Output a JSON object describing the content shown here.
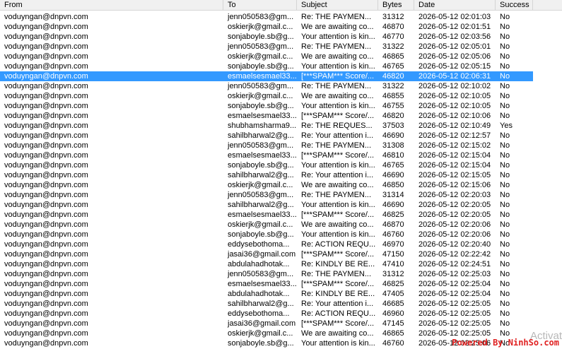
{
  "columns": [
    "From",
    "To",
    "Subject",
    "Bytes",
    "Date",
    "Success"
  ],
  "selected_index": 6,
  "rows": [
    [
      "voduyngan@dnpvn.com",
      "jenn050583@gm...",
      "Re: THE PAYMEN...",
      "31312",
      "2026-05-12 02:01:03",
      "No"
    ],
    [
      "voduyngan@dnpvn.com",
      "oskierjk@gmail.c...",
      "We are awaiting co...",
      "46870",
      "2026-05-12 02:01:51",
      "No"
    ],
    [
      "voduyngan@dnpvn.com",
      "sonjaboyle.sb@g...",
      "Your attention is kin...",
      "46770",
      "2026-05-12 02:03:56",
      "No"
    ],
    [
      "voduyngan@dnpvn.com",
      "jenn050583@gm...",
      "Re: THE PAYMEN...",
      "31322",
      "2026-05-12 02:05:01",
      "No"
    ],
    [
      "voduyngan@dnpvn.com",
      "oskierjk@gmail.c...",
      "We are awaiting co...",
      "46865",
      "2026-05-12 02:05:06",
      "No"
    ],
    [
      "voduyngan@dnpvn.com",
      "sonjaboyle.sb@g...",
      "Your attention is kin...",
      "46765",
      "2026-05-12 02:05:15",
      "No"
    ],
    [
      "voduyngan@dnpvn.com",
      "esmaelsesmael33...",
      "[***SPAM*** Score/...",
      "46820",
      "2026-05-12 02:06:31",
      "No"
    ],
    [
      "voduyngan@dnpvn.com",
      "jenn050583@gm...",
      "Re: THE PAYMEN...",
      "31322",
      "2026-05-12 02:10:02",
      "No"
    ],
    [
      "voduyngan@dnpvn.com",
      "oskierjk@gmail.c...",
      "We are awaiting co...",
      "46855",
      "2026-05-12 02:10:05",
      "No"
    ],
    [
      "voduyngan@dnpvn.com",
      "sonjaboyle.sb@g...",
      "Your attention is kin...",
      "46755",
      "2026-05-12 02:10:05",
      "No"
    ],
    [
      "voduyngan@dnpvn.com",
      "esmaelsesmael33...",
      "[***SPAM*** Score/...",
      "46820",
      "2026-05-12 02:10:06",
      "No"
    ],
    [
      "voduyngan@dnpvn.com",
      "shubhamsharma9...",
      "Re: THE REQUES...",
      "37503",
      "2026-05-12 02:10:49",
      "Yes"
    ],
    [
      "voduyngan@dnpvn.com",
      "sahilbharwal2@g...",
      "Re: Your attention i...",
      "46690",
      "2026-05-12 02:12:57",
      "No"
    ],
    [
      "voduyngan@dnpvn.com",
      "jenn050583@gm...",
      "Re: THE PAYMEN...",
      "31308",
      "2026-05-12 02:15:02",
      "No"
    ],
    [
      "voduyngan@dnpvn.com",
      "esmaelsesmael33...",
      "[***SPAM*** Score/...",
      "46810",
      "2026-05-12 02:15:04",
      "No"
    ],
    [
      "voduyngan@dnpvn.com",
      "sonjaboyle.sb@g...",
      "Your attention is kin...",
      "46765",
      "2026-05-12 02:15:04",
      "No"
    ],
    [
      "voduyngan@dnpvn.com",
      "sahilbharwal2@g...",
      "Re: Your attention i...",
      "46690",
      "2026-05-12 02:15:05",
      "No"
    ],
    [
      "voduyngan@dnpvn.com",
      "oskierjk@gmail.c...",
      "We are awaiting co...",
      "46850",
      "2026-05-12 02:15:06",
      "No"
    ],
    [
      "voduyngan@dnpvn.com",
      "jenn050583@gm...",
      "Re: THE PAYMEN...",
      "31314",
      "2026-05-12 02:20:03",
      "No"
    ],
    [
      "voduyngan@dnpvn.com",
      "sahilbharwal2@g...",
      "Your attention is kin...",
      "46690",
      "2026-05-12 02:20:05",
      "No"
    ],
    [
      "voduyngan@dnpvn.com",
      "esmaelsesmael33...",
      "[***SPAM*** Score/...",
      "46825",
      "2026-05-12 02:20:05",
      "No"
    ],
    [
      "voduyngan@dnpvn.com",
      "oskierjk@gmail.c...",
      "We are awaiting co...",
      "46870",
      "2026-05-12 02:20:06",
      "No"
    ],
    [
      "voduyngan@dnpvn.com",
      "sonjaboyle.sb@g...",
      "Your attention is kin...",
      "46760",
      "2026-05-12 02:20:06",
      "No"
    ],
    [
      "voduyngan@dnpvn.com",
      "eddysebothoma...",
      "Re: ACTION REQU...",
      "46970",
      "2026-05-12 02:20:40",
      "No"
    ],
    [
      "voduyngan@dnpvn.com",
      "jasai36@gmail.com",
      "[***SPAM*** Score/...",
      "47150",
      "2026-05-12 02:22:42",
      "No"
    ],
    [
      "voduyngan@dnpvn.com",
      "abdulahadhotak...",
      "Re: KINDLY BE RE...",
      "47410",
      "2026-05-12 02:24:51",
      "No"
    ],
    [
      "voduyngan@dnpvn.com",
      "jenn050583@gm...",
      "Re: THE PAYMEN...",
      "31312",
      "2026-05-12 02:25:03",
      "No"
    ],
    [
      "voduyngan@dnpvn.com",
      "esmaelsesmael33...",
      "[***SPAM*** Score/...",
      "46825",
      "2026-05-12 02:25:04",
      "No"
    ],
    [
      "voduyngan@dnpvn.com",
      "abdulahadhotak...",
      "Re: KINDLY BE RE...",
      "47405",
      "2026-05-12 02:25:04",
      "No"
    ],
    [
      "voduyngan@dnpvn.com",
      "sahilbharwal2@g...",
      "Re: Your attention i...",
      "46685",
      "2026-05-12 02:25:05",
      "No"
    ],
    [
      "voduyngan@dnpvn.com",
      "eddysebothoma...",
      "Re: ACTION REQU...",
      "46960",
      "2026-05-12 02:25:05",
      "No"
    ],
    [
      "voduyngan@dnpvn.com",
      "jasai36@gmail.com",
      "[***SPAM*** Score/...",
      "47145",
      "2026-05-12 02:25:05",
      "No"
    ],
    [
      "voduyngan@dnpvn.com",
      "oskierjk@gmail.c...",
      "We are awaiting co...",
      "46865",
      "2026-05-12 02:25:05",
      "No"
    ],
    [
      "voduyngan@dnpvn.com",
      "sonjaboyle.sb@g...",
      "Your attention is kin...",
      "46760",
      "2026-05-12 02:25:06",
      "No"
    ]
  ],
  "overlay": {
    "activate_text": "Activat",
    "watermark": "Powered By NinhSo.com"
  }
}
